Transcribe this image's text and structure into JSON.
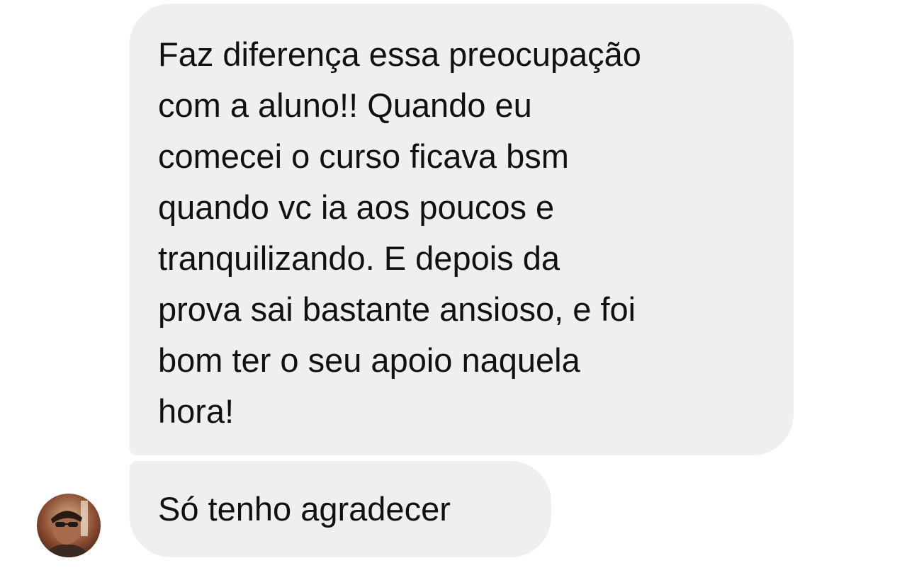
{
  "conversation": {
    "messages": [
      {
        "lines": [
          "Faz diferença essa preocupação",
          "com a aluno!! Quando eu",
          "comecei o curso ficava bsm",
          "quando vc ia aos poucos e",
          "tranquilizando. E depois da",
          "prova sai bastante ansioso, e foi",
          "bom ter o seu apoio naquela",
          "hora!"
        ]
      },
      {
        "lines": [
          "Só tenho agradecer"
        ]
      }
    ],
    "avatar_icon": "sender-avatar-photo"
  },
  "colors": {
    "bubble_background": "#efefef",
    "text": "#111111",
    "page_background": "#ffffff"
  }
}
